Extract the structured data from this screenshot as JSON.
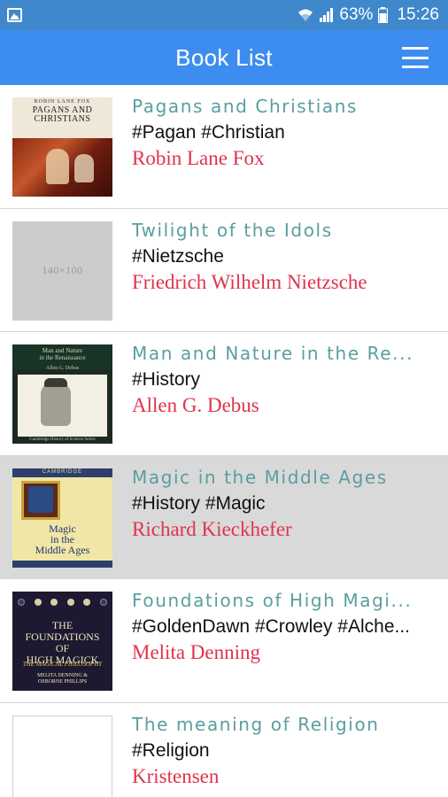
{
  "status_bar": {
    "battery_percent": "63%",
    "time": "15:26",
    "icons": [
      "gallery-icon",
      "wifi-icon",
      "signal-icon",
      "battery-icon"
    ]
  },
  "app_bar": {
    "title": "Book List",
    "menu_icon": "hamburger-menu-icon"
  },
  "colors": {
    "status_bar_bg": "#3f88cc",
    "app_bar_bg": "#3d8df0",
    "title_color": "#5a9ea0",
    "author_color": "#e0334d",
    "selected_row_bg": "#d9d9d9"
  },
  "books": [
    {
      "title": "Pagans and Christians",
      "tags": "#Pagan #Christian",
      "author": "Robin Lane Fox",
      "cover": {
        "author_line": "ROBIN LANE FOX",
        "title_line1": "PAGANS AND",
        "title_line2": "CHRISTIANS"
      }
    },
    {
      "title": "Twilight of the Idols",
      "tags": "#Nietzsche",
      "author": "Friedrich Wilhelm Nietzsche",
      "cover": {
        "placeholder": "140×100"
      }
    },
    {
      "title": "Man and Nature in the Re...",
      "tags": "#History",
      "author": "Allen G. Debus",
      "cover": {
        "title_line1": "Man and Nature",
        "title_line2": "in the Renaissance",
        "author_line": "Allen G. Debus",
        "footer": "Cambridge History of Science Series"
      }
    },
    {
      "title": "Magic in the Middle Ages",
      "tags": "#History #Magic",
      "author": "Richard Kieckhefer",
      "selected": true,
      "cover": {
        "band": "CAMBRIDGE",
        "title_line1": "Magic",
        "title_line2": "in the",
        "title_line3": "Middle Ages"
      }
    },
    {
      "title": "Foundations of High Magi...",
      "tags": "#GoldenDawn #Crowley #Alche...",
      "author": "Melita Denning",
      "cover": {
        "title_line1": "THE",
        "title_line2": "FOUNDATIONS",
        "title_line3": "OF",
        "title_line4": "HIGH MAGICK",
        "subtitle": "THE MAGICAL PHILOSOPHY",
        "author_line1": "MELITA DENNING &",
        "author_line2": "OSBORNE PHILLIPS"
      }
    },
    {
      "title": "The meaning of Religion",
      "tags": "#Religion",
      "author": "Kristensen",
      "cover": {}
    }
  ]
}
